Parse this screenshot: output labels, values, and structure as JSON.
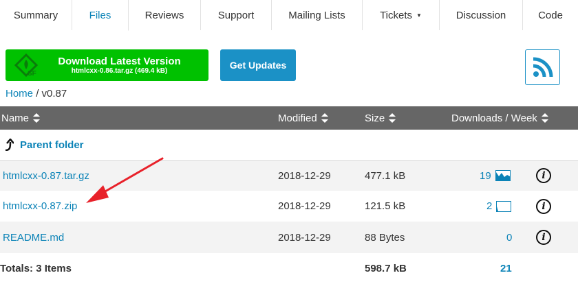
{
  "tabs": [
    {
      "label": "Summary"
    },
    {
      "label": "Files"
    },
    {
      "label": "Reviews"
    },
    {
      "label": "Support"
    },
    {
      "label": "Mailing Lists"
    },
    {
      "label": "Tickets"
    },
    {
      "label": "Discussion"
    },
    {
      "label": "Code"
    }
  ],
  "download": {
    "title": "Download Latest Version",
    "subtitle": "htmlcxx-0.86.tar.gz (469.4 kB)"
  },
  "updates_label": "Get Updates",
  "breadcrumb": {
    "home": "Home",
    "separator": "/",
    "current": "v0.87"
  },
  "table": {
    "headers": {
      "name": "Name",
      "modified": "Modified",
      "size": "Size",
      "downloads": "Downloads / Week"
    },
    "parent_folder": "Parent folder",
    "rows": [
      {
        "name": "htmlcxx-0.87.tar.gz",
        "modified": "2018-12-29",
        "size": "477.1 kB",
        "downloads": "19"
      },
      {
        "name": "htmlcxx-0.87.zip",
        "modified": "2018-12-29",
        "size": "121.5 kB",
        "downloads": "2"
      },
      {
        "name": "README.md",
        "modified": "2018-12-29",
        "size": "88 Bytes",
        "downloads": "0"
      }
    ],
    "totals": {
      "label": "Totals: 3 Items",
      "size": "598.7 kB",
      "downloads": "21"
    }
  },
  "colors": {
    "accent": "#0b83b7",
    "download_green": "#00c100",
    "header_gray": "#666666",
    "annotation_red": "#e8212a"
  },
  "icons": [
    "sf-logo-icon",
    "rss-icon",
    "sort-icon",
    "parent-folder-arrow-icon",
    "sparkline-icon",
    "info-icon",
    "red-arrow-annotation"
  ]
}
